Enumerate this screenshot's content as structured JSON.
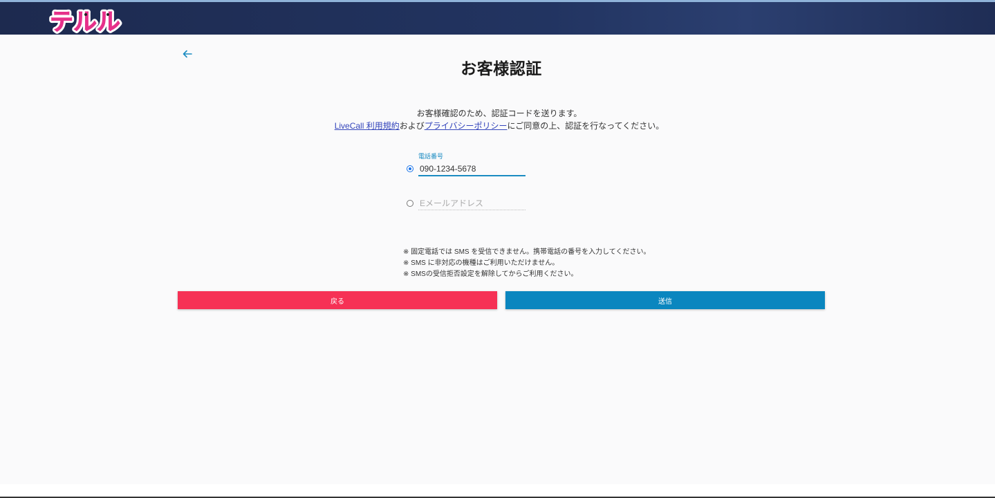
{
  "header": {
    "logo_text": "テルル",
    "logo_color": "#e6318a"
  },
  "page": {
    "title": "お客様認証",
    "intro_line1": "お客様確認のため、認証コードを送ります。",
    "terms_link": "LiveCall 利用規約",
    "and_text": "および",
    "privacy_link": "プライバシーポリシー",
    "intro_line2_suffix": "にご同意の上、認証を行なってください。"
  },
  "form": {
    "phone_label": "電話番号",
    "phone_value": "090-1234-5678",
    "email_placeholder": "Eメールアドレス",
    "selected": "phone"
  },
  "notes": [
    "※ 固定電話では SMS を受信できません。携帯電話の番号を入力してください。",
    "※ SMS に非対応の機種はご利用いただけません。",
    "※ SMSの受信拒否設定を解除してからご利用ください。"
  ],
  "buttons": {
    "back_label": "戻る",
    "send_label": "送信"
  },
  "colors": {
    "back_button": "#f63155",
    "send_button": "#0a86bf",
    "accent": "#1a8bc2",
    "header": "#223461"
  }
}
